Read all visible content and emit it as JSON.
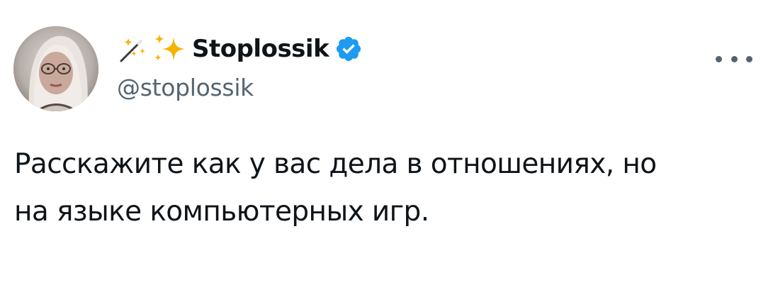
{
  "author": {
    "display_name": "Stoplossik",
    "handle": "@stoplossik",
    "name_emojis": [
      "magic-wand-icon",
      "sparkles-icon"
    ],
    "verified": true,
    "verified_color": "#1d9bf0"
  },
  "tweet": {
    "text_lines": [
      "Расскажите как у вас дела в отношениях, но",
      "на языке компьютерных игр."
    ]
  },
  "colors": {
    "text": "#0f1419",
    "secondary_text": "#536471",
    "background": "#ffffff"
  }
}
